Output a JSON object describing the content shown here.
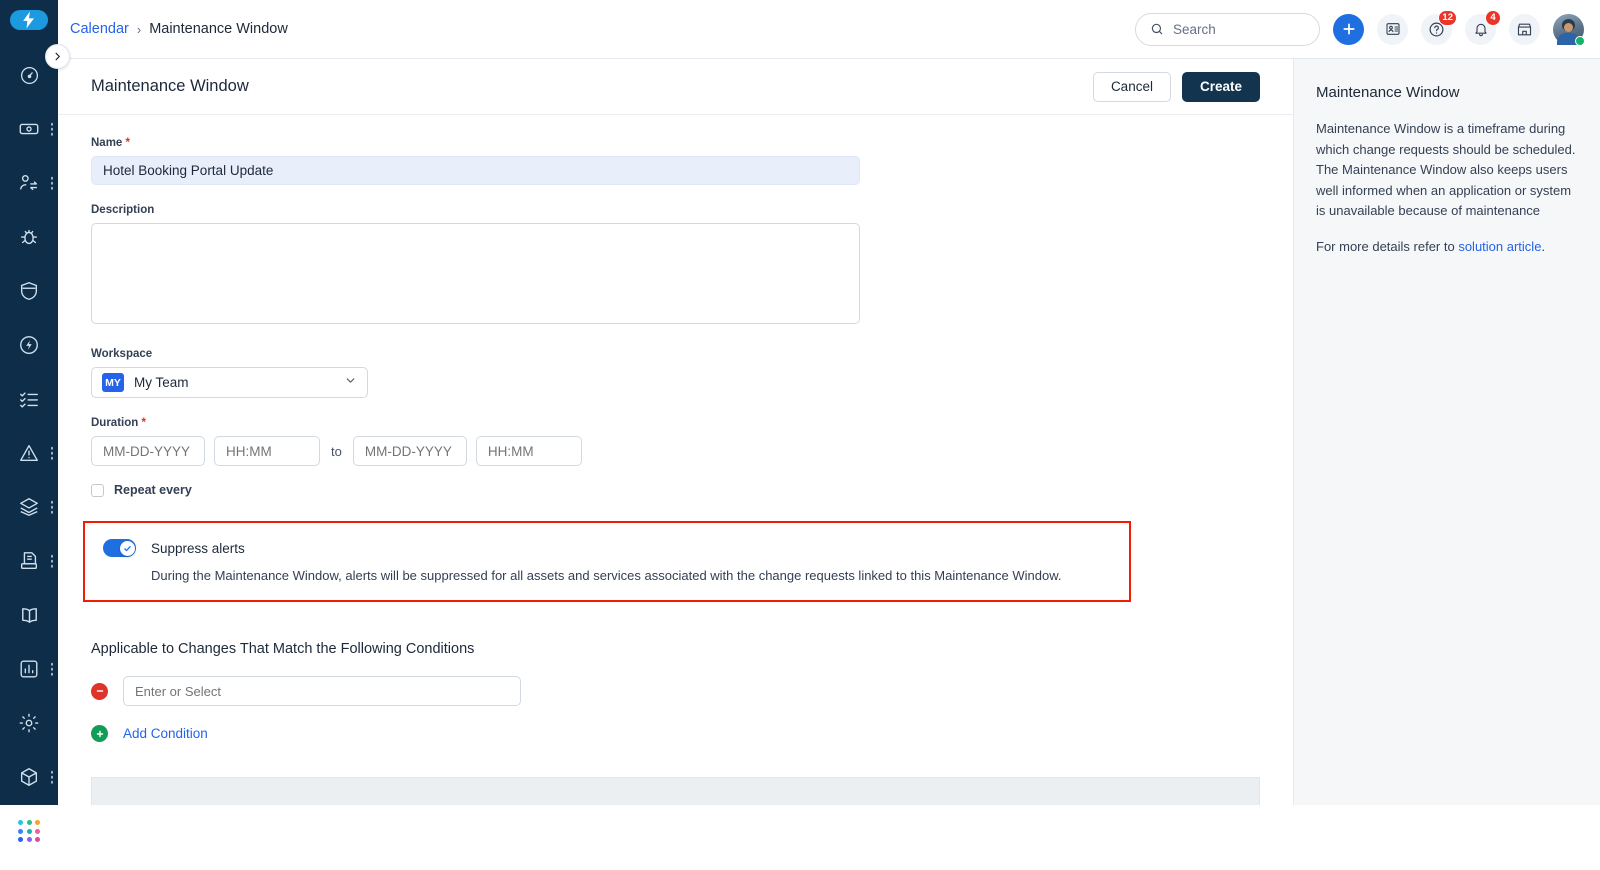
{
  "rail": {
    "logo_icon": "lightning-bolt-logo",
    "expand_icon": "chevron-right-icon",
    "items": [
      {
        "name": "dashboard",
        "icon": "speedometer-icon",
        "has_dots": false
      },
      {
        "name": "tickets",
        "icon": "ticket-icon",
        "has_dots": true
      },
      {
        "name": "changes",
        "icon": "user-swap-icon",
        "has_dots": true
      },
      {
        "name": "problems",
        "icon": "bug-icon",
        "has_dots": false
      },
      {
        "name": "security",
        "icon": "shield-icon",
        "has_dots": false
      },
      {
        "name": "automation",
        "icon": "flash-circle-icon",
        "has_dots": false
      },
      {
        "name": "tasks",
        "icon": "checklist-icon",
        "has_dots": false
      },
      {
        "name": "alerts",
        "icon": "alert-triangle-icon",
        "has_dots": true
      },
      {
        "name": "assets",
        "icon": "layers-icon",
        "has_dots": true
      },
      {
        "name": "releases",
        "icon": "archive-doc-icon",
        "has_dots": true
      },
      {
        "name": "knowledge",
        "icon": "book-open-icon",
        "has_dots": false
      },
      {
        "name": "analytics",
        "icon": "bar-chart-icon",
        "has_dots": true
      },
      {
        "name": "admin",
        "icon": "gear-icon",
        "has_dots": false
      }
    ],
    "bottom_items": [
      {
        "name": "products",
        "icon": "cube-icon",
        "has_dots": true
      },
      {
        "name": "app-switcher",
        "icon": "app-grid-icon",
        "has_dots": false
      }
    ],
    "grid_colors": [
      "#22c7e0",
      "#27c08a",
      "#f5a623",
      "#3b82f6",
      "#16b3a8",
      "#ec5fa0",
      "#2563eb",
      "#8b5cf6",
      "#e0479e"
    ]
  },
  "topbar": {
    "breadcrumb": {
      "root": "Calendar",
      "separator": "›",
      "current": "Maintenance Window"
    },
    "search": {
      "placeholder": "Search",
      "icon": "search-icon"
    },
    "actions": [
      {
        "name": "create-new",
        "icon": "plus-icon",
        "badge": null
      },
      {
        "name": "contacts",
        "icon": "contact-card-icon",
        "badge": null
      },
      {
        "name": "help",
        "icon": "question-circle-icon",
        "badge": "12"
      },
      {
        "name": "notifications",
        "icon": "bell-icon",
        "badge": "4"
      },
      {
        "name": "marketplace",
        "icon": "storefront-icon",
        "badge": null
      }
    ],
    "avatar": {
      "name": "user-avatar",
      "status": "online"
    }
  },
  "page": {
    "title": "Maintenance Window",
    "cancel_label": "Cancel",
    "create_label": "Create"
  },
  "form": {
    "name": {
      "label": "Name",
      "required": true,
      "value": "Hotel Booking Portal Update"
    },
    "description": {
      "label": "Description",
      "value": "",
      "placeholder": ""
    },
    "workspace": {
      "label": "Workspace",
      "badge": "MY",
      "value": "My Team",
      "chevron": "chevron-down-icon"
    },
    "duration": {
      "label": "Duration",
      "required": true,
      "start_date_placeholder": "MM-DD-YYYY",
      "start_time_placeholder": "HH:MM",
      "separator": "to",
      "end_date_placeholder": "MM-DD-YYYY",
      "end_time_placeholder": "HH:MM"
    },
    "repeat": {
      "label": "Repeat every",
      "checked": false
    },
    "suppress": {
      "title": "Suppress alerts",
      "enabled": true,
      "description": "During the Maintenance Window, alerts will be suppressed for all assets and services associated with the change requests linked to this Maintenance Window."
    },
    "conditions": {
      "title": "Applicable to Changes That Match the Following Conditions",
      "remove_icon": "minus-circle-icon",
      "input_placeholder": "Enter or Select",
      "add_icon": "plus-circle-icon",
      "add_label": "Add Condition"
    }
  },
  "right_panel": {
    "title": "Maintenance Window",
    "paragraph": "Maintenance Window is a timeframe during which change requests should be scheduled. The Maintenance Window also keeps users well informed when an application or system is unavailable because of maintenance",
    "footer_prefix": "For more details refer to ",
    "footer_link": "solution article",
    "footer_suffix": "."
  },
  "colors": {
    "rail_bg": "#0e2d48",
    "accent_blue": "#2563eb",
    "create_btn": "#12344f",
    "highlight_red": "#f31b00",
    "badge_red": "#e8362b",
    "online_green": "#17b26a"
  }
}
